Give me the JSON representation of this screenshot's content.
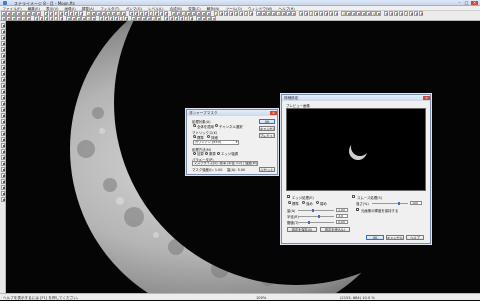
{
  "window": {
    "title": "ステライメージ 8 - 月 - Moon.fts"
  },
  "menubar": {
    "items": [
      "ファイル(F)",
      "編集(E)",
      "表示(V)",
      "画像(I)",
      "調整(A)",
      "フィルタ(T)",
      "ガンマ(G)",
      "レベル(L)",
      "合成(B)",
      "変換(C)",
      "解析(N)",
      "ツール(O)",
      "ウィンドウ(W)",
      "ヘルプ(H)"
    ]
  },
  "dialog1": {
    "title": "非シャープマスク",
    "section_apply": "処理対象(A)",
    "radio_all": "全体を適用",
    "radio_channel": "チャンネル選択",
    "section_kernel": "マトリックス(K)",
    "radio_normal": "標準",
    "radio_custom": "詳細",
    "kernel_value": "ガウシアン (9×9)",
    "section_mode": "処理方法(M)",
    "radio_mode1": "加算",
    "radio_mode2": "乗算",
    "radio_mode3": "エッジ強調",
    "section_param": "パラメータ(P)",
    "param_line1": "マスクサイズ(S): 標準 (半径 3.0) / 強度(W): 100 %",
    "param_value1": "マスク強度(I): 1.00",
    "param_value2": "量(A): 5.00",
    "btn_ok": "OK",
    "btn_cancel": "キャンセル",
    "btn_preview": "プレビュー",
    "btn_reset": "リセット"
  },
  "dialog2": {
    "title": "詳細設定",
    "preview_label": "プレビュー画像",
    "chk_edge": "エッジ処理(E)",
    "chk_smooth": "スムース処理(S)",
    "radio_a": "標準",
    "radio_b": "強め",
    "radio_c": "弱め",
    "label_amount": "量(A)",
    "amount_value": "1.00",
    "label_radius": "半径(R)",
    "radius_value": "3.0",
    "label_threshold": "閾値(T)",
    "threshold_value": "0.00",
    "label_amount_pct": "強さ(%)",
    "amount_pct_value": "100",
    "chk_keep": "元画像の輝度を保持する",
    "btn_save": "設定を保存(S)",
    "btn_load": "設定を読込(L)",
    "btn_ok": "OK",
    "btn_cancel": "キャンセル",
    "btn_help": "ヘルプ"
  },
  "status": {
    "help_text": "ヘルプを表示するには [F1] を押してください。",
    "middle": "100%",
    "right": "(2153, 684) 10.0 %"
  },
  "colors": {
    "accent": "#2d6fd0",
    "close": "#c94a3a",
    "canvas_bg": "#050505"
  },
  "icons": [
    "app-icon",
    "minimize-icon",
    "maximize-icon",
    "close-icon"
  ]
}
